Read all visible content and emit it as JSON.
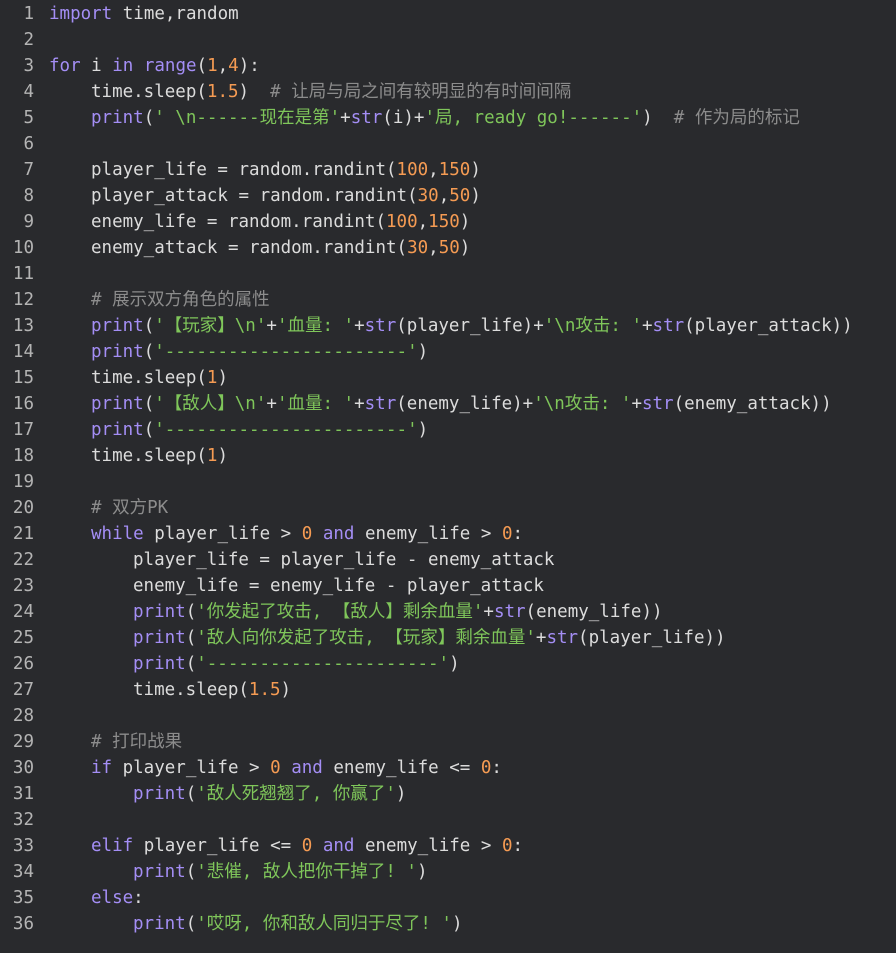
{
  "editor": {
    "colors": {
      "background": "#292a2d",
      "plain": "#dcdcdc",
      "keyword": "#a48ef5",
      "number": "#f59b53",
      "string": "#7fc65a",
      "comment": "#8c8c8c",
      "gutter": "#b4b4b4"
    },
    "lines": [
      {
        "n": "1",
        "indent": 0,
        "tokens": [
          [
            "kw",
            "import"
          ],
          [
            "plain",
            " time,random"
          ]
        ]
      },
      {
        "n": "2",
        "indent": 0,
        "tokens": []
      },
      {
        "n": "3",
        "indent": 0,
        "tokens": [
          [
            "kw",
            "for"
          ],
          [
            "plain",
            " i "
          ],
          [
            "kw",
            "in"
          ],
          [
            "plain",
            " "
          ],
          [
            "fn",
            "range"
          ],
          [
            "plain",
            "("
          ],
          [
            "num",
            "1"
          ],
          [
            "plain",
            ","
          ],
          [
            "num",
            "4"
          ],
          [
            "plain",
            "):"
          ]
        ]
      },
      {
        "n": "4",
        "indent": 1,
        "tokens": [
          [
            "plain",
            "time.sleep("
          ],
          [
            "num",
            "1.5"
          ],
          [
            "plain",
            ")  "
          ],
          [
            "com",
            "# 让局与局之间有较明显的有时间间隔"
          ]
        ]
      },
      {
        "n": "5",
        "indent": 1,
        "tokens": [
          [
            "fn",
            "print"
          ],
          [
            "plain",
            "("
          ],
          [
            "str",
            "' \\n------现在是第'"
          ],
          [
            "plain",
            "+"
          ],
          [
            "fn",
            "str"
          ],
          [
            "plain",
            "(i)+"
          ],
          [
            "str",
            "'局, ready go!------'"
          ],
          [
            "plain",
            ")  "
          ],
          [
            "com",
            "# 作为局的标记"
          ]
        ]
      },
      {
        "n": "6",
        "indent": 0,
        "tokens": []
      },
      {
        "n": "7",
        "indent": 1,
        "tokens": [
          [
            "plain",
            "player_life = random.randint("
          ],
          [
            "num",
            "100"
          ],
          [
            "plain",
            ","
          ],
          [
            "num",
            "150"
          ],
          [
            "plain",
            ")"
          ]
        ]
      },
      {
        "n": "8",
        "indent": 1,
        "tokens": [
          [
            "plain",
            "player_attack = random.randint("
          ],
          [
            "num",
            "30"
          ],
          [
            "plain",
            ","
          ],
          [
            "num",
            "50"
          ],
          [
            "plain",
            ")"
          ]
        ]
      },
      {
        "n": "9",
        "indent": 1,
        "tokens": [
          [
            "plain",
            "enemy_life = random.randint("
          ],
          [
            "num",
            "100"
          ],
          [
            "plain",
            ","
          ],
          [
            "num",
            "150"
          ],
          [
            "plain",
            ")"
          ]
        ]
      },
      {
        "n": "10",
        "indent": 1,
        "tokens": [
          [
            "plain",
            "enemy_attack = random.randint("
          ],
          [
            "num",
            "30"
          ],
          [
            "plain",
            ","
          ],
          [
            "num",
            "50"
          ],
          [
            "plain",
            ")"
          ]
        ]
      },
      {
        "n": "11",
        "indent": 0,
        "tokens": []
      },
      {
        "n": "12",
        "indent": 1,
        "tokens": [
          [
            "com",
            "# 展示双方角色的属性"
          ]
        ]
      },
      {
        "n": "13",
        "indent": 1,
        "tokens": [
          [
            "fn",
            "print"
          ],
          [
            "plain",
            "("
          ],
          [
            "str",
            "'【玩家】\\n'"
          ],
          [
            "plain",
            "+"
          ],
          [
            "str",
            "'血量: '"
          ],
          [
            "plain",
            "+"
          ],
          [
            "fn",
            "str"
          ],
          [
            "plain",
            "(player_life)+"
          ],
          [
            "str",
            "'\\n攻击: '"
          ],
          [
            "plain",
            "+"
          ],
          [
            "fn",
            "str"
          ],
          [
            "plain",
            "(player_attack))"
          ]
        ]
      },
      {
        "n": "14",
        "indent": 1,
        "tokens": [
          [
            "fn",
            "print"
          ],
          [
            "plain",
            "("
          ],
          [
            "str",
            "'-----------------------'"
          ],
          [
            "plain",
            ")"
          ]
        ]
      },
      {
        "n": "15",
        "indent": 1,
        "tokens": [
          [
            "plain",
            "time.sleep("
          ],
          [
            "num",
            "1"
          ],
          [
            "plain",
            ")"
          ]
        ]
      },
      {
        "n": "16",
        "indent": 1,
        "tokens": [
          [
            "fn",
            "print"
          ],
          [
            "plain",
            "("
          ],
          [
            "str",
            "'【敌人】\\n'"
          ],
          [
            "plain",
            "+"
          ],
          [
            "str",
            "'血量: '"
          ],
          [
            "plain",
            "+"
          ],
          [
            "fn",
            "str"
          ],
          [
            "plain",
            "(enemy_life)+"
          ],
          [
            "str",
            "'\\n攻击: '"
          ],
          [
            "plain",
            "+"
          ],
          [
            "fn",
            "str"
          ],
          [
            "plain",
            "(enemy_attack))"
          ]
        ]
      },
      {
        "n": "17",
        "indent": 1,
        "tokens": [
          [
            "fn",
            "print"
          ],
          [
            "plain",
            "("
          ],
          [
            "str",
            "'-----------------------'"
          ],
          [
            "plain",
            ")"
          ]
        ]
      },
      {
        "n": "18",
        "indent": 1,
        "tokens": [
          [
            "plain",
            "time.sleep("
          ],
          [
            "num",
            "1"
          ],
          [
            "plain",
            ")"
          ]
        ]
      },
      {
        "n": "19",
        "indent": 0,
        "tokens": []
      },
      {
        "n": "20",
        "indent": 1,
        "tokens": [
          [
            "com",
            "# 双方PK"
          ]
        ]
      },
      {
        "n": "21",
        "indent": 1,
        "tokens": [
          [
            "kw",
            "while"
          ],
          [
            "plain",
            " player_life > "
          ],
          [
            "num",
            "0"
          ],
          [
            "plain",
            " "
          ],
          [
            "kw",
            "and"
          ],
          [
            "plain",
            " enemy_life > "
          ],
          [
            "num",
            "0"
          ],
          [
            "plain",
            ":"
          ]
        ]
      },
      {
        "n": "22",
        "indent": 2,
        "tokens": [
          [
            "plain",
            "player_life = player_life - enemy_attack"
          ]
        ]
      },
      {
        "n": "23",
        "indent": 2,
        "tokens": [
          [
            "plain",
            "enemy_life = enemy_life - player_attack"
          ]
        ]
      },
      {
        "n": "24",
        "indent": 2,
        "tokens": [
          [
            "fn",
            "print"
          ],
          [
            "plain",
            "("
          ],
          [
            "str",
            "'你发起了攻击, 【敌人】剩余血量'"
          ],
          [
            "plain",
            "+"
          ],
          [
            "fn",
            "str"
          ],
          [
            "plain",
            "(enemy_life))"
          ]
        ]
      },
      {
        "n": "25",
        "indent": 2,
        "tokens": [
          [
            "fn",
            "print"
          ],
          [
            "plain",
            "("
          ],
          [
            "str",
            "'敌人向你发起了攻击, 【玩家】剩余血量'"
          ],
          [
            "plain",
            "+"
          ],
          [
            "fn",
            "str"
          ],
          [
            "plain",
            "(player_life))"
          ]
        ]
      },
      {
        "n": "26",
        "indent": 2,
        "tokens": [
          [
            "fn",
            "print"
          ],
          [
            "plain",
            "("
          ],
          [
            "str",
            "'----------------------'"
          ],
          [
            "plain",
            ")"
          ]
        ]
      },
      {
        "n": "27",
        "indent": 2,
        "tokens": [
          [
            "plain",
            "time.sleep("
          ],
          [
            "num",
            "1.5"
          ],
          [
            "plain",
            ")"
          ]
        ]
      },
      {
        "n": "28",
        "indent": 0,
        "tokens": []
      },
      {
        "n": "29",
        "indent": 1,
        "tokens": [
          [
            "com",
            "# 打印战果"
          ]
        ]
      },
      {
        "n": "30",
        "indent": 1,
        "tokens": [
          [
            "kw",
            "if"
          ],
          [
            "plain",
            " player_life > "
          ],
          [
            "num",
            "0"
          ],
          [
            "plain",
            " "
          ],
          [
            "kw",
            "and"
          ],
          [
            "plain",
            " enemy_life <= "
          ],
          [
            "num",
            "0"
          ],
          [
            "plain",
            ":"
          ]
        ]
      },
      {
        "n": "31",
        "indent": 2,
        "tokens": [
          [
            "fn",
            "print"
          ],
          [
            "plain",
            "("
          ],
          [
            "str",
            "'敌人死翘翘了, 你赢了'"
          ],
          [
            "plain",
            ")"
          ]
        ]
      },
      {
        "n": "32",
        "indent": 0,
        "tokens": []
      },
      {
        "n": "33",
        "indent": 1,
        "tokens": [
          [
            "kw",
            "elif"
          ],
          [
            "plain",
            " player_life <= "
          ],
          [
            "num",
            "0"
          ],
          [
            "plain",
            " "
          ],
          [
            "kw",
            "and"
          ],
          [
            "plain",
            " enemy_life > "
          ],
          [
            "num",
            "0"
          ],
          [
            "plain",
            ":"
          ]
        ]
      },
      {
        "n": "34",
        "indent": 2,
        "tokens": [
          [
            "fn",
            "print"
          ],
          [
            "plain",
            "("
          ],
          [
            "str",
            "'悲催, 敌人把你干掉了! '"
          ],
          [
            "plain",
            ")"
          ]
        ]
      },
      {
        "n": "35",
        "indent": 1,
        "tokens": [
          [
            "kw",
            "else"
          ],
          [
            "plain",
            ":"
          ]
        ]
      },
      {
        "n": "36",
        "indent": 2,
        "tokens": [
          [
            "fn",
            "print"
          ],
          [
            "plain",
            "("
          ],
          [
            "str",
            "'哎呀, 你和敌人同归于尽了! '"
          ],
          [
            "plain",
            ")"
          ]
        ]
      }
    ]
  }
}
